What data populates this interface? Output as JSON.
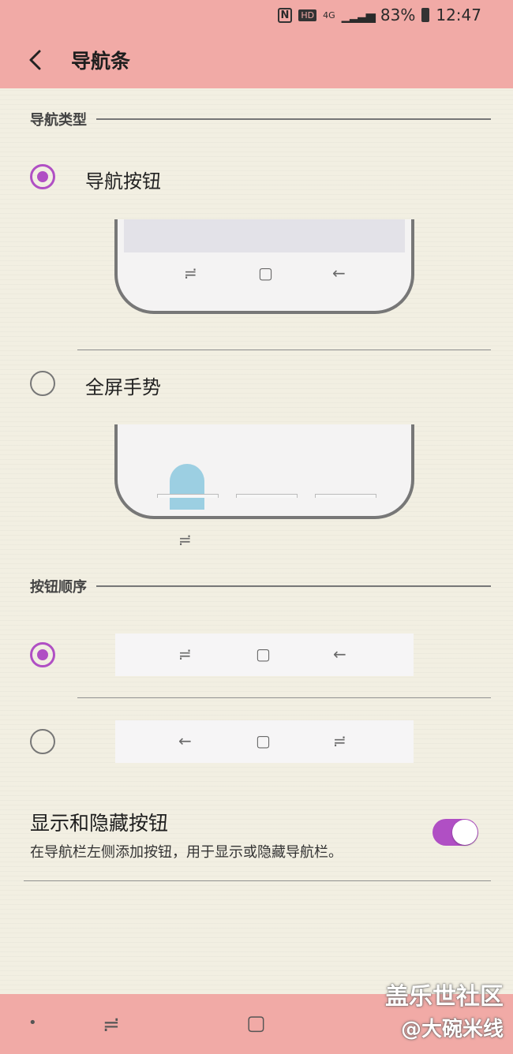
{
  "status": {
    "icons": [
      "nfc-icon",
      "hd-icon",
      "4g-icon",
      "signal-icon",
      "battery-icon"
    ],
    "hd_text": "HD",
    "net_text": "4G",
    "battery_percent": "83%",
    "time": "12:47"
  },
  "header": {
    "title": "导航条"
  },
  "nav_type": {
    "header": "导航类型",
    "options": [
      {
        "label": "导航按钮",
        "selected": true
      },
      {
        "label": "全屏手势",
        "selected": false
      }
    ]
  },
  "button_order": {
    "header": "按钮顺序",
    "options": [
      {
        "order": [
          "recents",
          "home",
          "back"
        ],
        "selected": true
      },
      {
        "order": [
          "back",
          "home",
          "recents"
        ],
        "selected": false
      }
    ]
  },
  "show_hide": {
    "title": "显示和隐藏按钮",
    "description": "在导航栏左侧添加按钮，用于显示或隐藏导航栏。",
    "enabled": true
  },
  "glyphs": {
    "recents": "≓",
    "home": "▢",
    "back": "←",
    "dot": "•"
  },
  "watermark": {
    "line1": "盖乐世社区",
    "line2": "@大碗米线"
  },
  "colors": {
    "accent": "#b04fc4",
    "bar": "#f1aaa6",
    "background": "#f2efe2"
  }
}
